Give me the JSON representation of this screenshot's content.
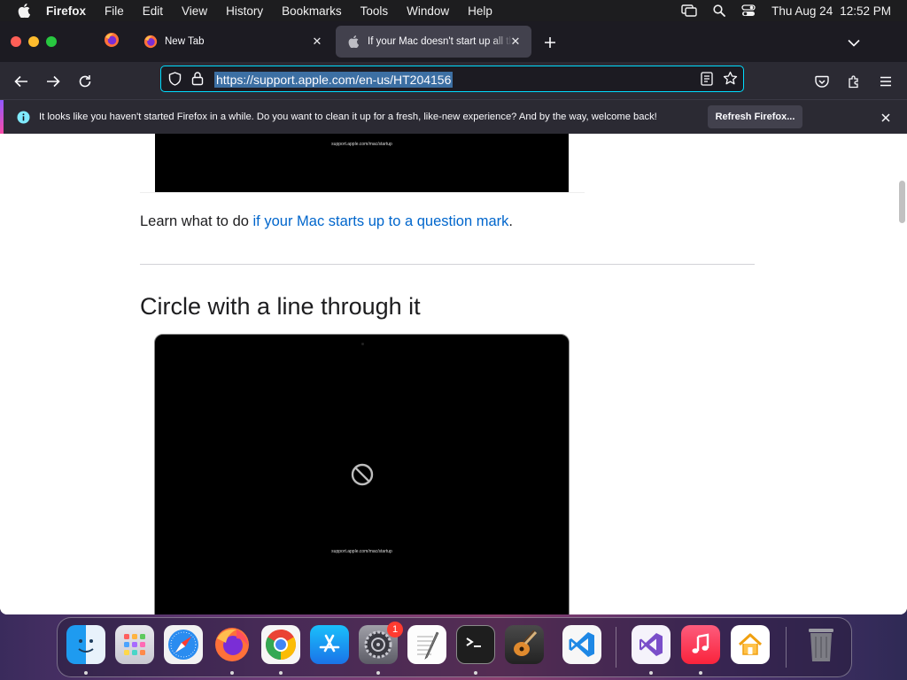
{
  "menubar": {
    "app_name": "Firefox",
    "items": [
      "File",
      "Edit",
      "View",
      "History",
      "Bookmarks",
      "Tools",
      "Window",
      "Help"
    ],
    "date": "Thu Aug 24",
    "time": "12:52 PM"
  },
  "tabs": [
    {
      "title": "New Tab",
      "icon": "firefox-icon"
    },
    {
      "title": "If your Mac doesn't start up all the way",
      "icon": "apple-icon",
      "active": true
    }
  ],
  "address_bar": {
    "url": "https://support.apple.com/en-us/HT204156"
  },
  "notification": {
    "message": "It looks like you haven't started Firefox in a while. Do you want to clean it up for a fresh, like-new experience? And by the way, welcome back!",
    "button": "Refresh Firefox..."
  },
  "page": {
    "screen_caption_top": "support.apple.com/mac/startup",
    "paragraph_prefix": "Learn what to do ",
    "paragraph_link": "if your Mac starts up to a question mark",
    "paragraph_suffix": ".",
    "heading": "Circle with a line through it",
    "screen_caption_bottom": "support.apple.com/mac/startup"
  },
  "dock": {
    "apps": [
      {
        "name": "Finder",
        "icon": "finder-icon",
        "running": true
      },
      {
        "name": "Launchpad",
        "icon": "launchpad-icon",
        "running": false
      },
      {
        "name": "Safari",
        "icon": "safari-icon",
        "running": false
      },
      {
        "name": "Firefox",
        "icon": "firefox-icon",
        "running": true
      },
      {
        "name": "Chrome",
        "icon": "chrome-icon",
        "running": true
      },
      {
        "name": "App Store",
        "icon": "app-store-icon",
        "running": false
      },
      {
        "name": "System Settings",
        "icon": "system-settings-icon",
        "running": true,
        "badge": "1"
      },
      {
        "name": "TextEdit",
        "icon": "textedit-icon",
        "running": false
      },
      {
        "name": "Terminal",
        "icon": "terminal-icon",
        "running": true
      },
      {
        "name": "GarageBand",
        "icon": "garageband-icon",
        "running": false
      },
      {
        "name": "Visual Studio Code",
        "icon": "vscode-icon",
        "running": false
      },
      {
        "name": "Visual Studio",
        "icon": "visual-studio-icon",
        "running": true
      },
      {
        "name": "Music",
        "icon": "music-icon",
        "running": true
      },
      {
        "name": "Home",
        "icon": "home-icon",
        "running": false
      },
      {
        "name": "Trash",
        "icon": "trash-icon",
        "running": false
      }
    ]
  },
  "colors": {
    "accent": "#00ddff",
    "link": "#0066cc",
    "badge": "#ff3b30"
  }
}
